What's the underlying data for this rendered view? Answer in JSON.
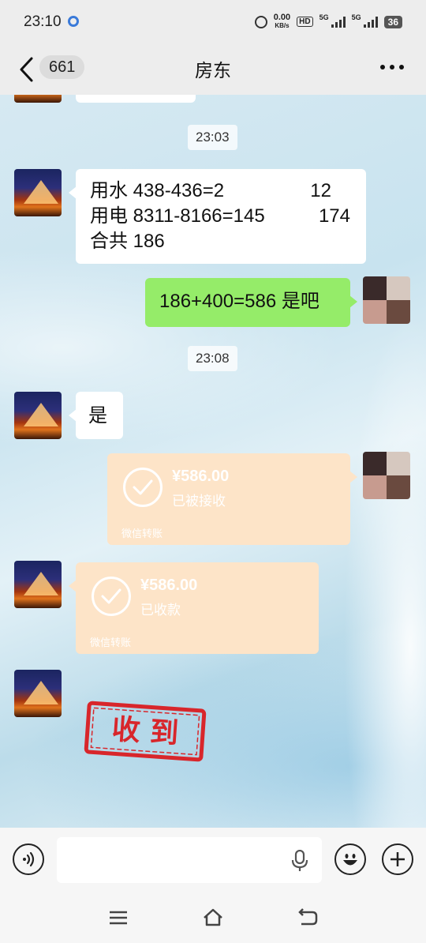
{
  "status_bar": {
    "time": "23:10",
    "net_speed_value": "0.00",
    "net_speed_unit": "KB/s",
    "hd_label": "HD",
    "network_1": "5G",
    "network_2": "5G",
    "battery": "36"
  },
  "header": {
    "unread_count": "661",
    "title": "房东"
  },
  "messages": {
    "time_1": "23:03",
    "bill": {
      "line1_label": "用水 438-436=2",
      "line1_value": "12",
      "line2_label": "用电 8311-8166=145",
      "line2_value": "174",
      "line3": "合共 186"
    },
    "self_reply": "186+400=586 是吧",
    "time_2": "23:08",
    "landlord_reply": "是",
    "transfer_sent": {
      "amount": "¥586.00",
      "status": "已被接收",
      "footer": "微信转账"
    },
    "transfer_received": {
      "amount": "¥586.00",
      "status": "已收款",
      "footer": "微信转账"
    },
    "stamp_sticker": "收 到"
  },
  "input_bar": {
    "placeholder": ""
  },
  "colors": {
    "outgoing_bubble": "#95ec69",
    "transfer_bubble": "#fde4c8",
    "stamp_red": "#d8262b"
  }
}
